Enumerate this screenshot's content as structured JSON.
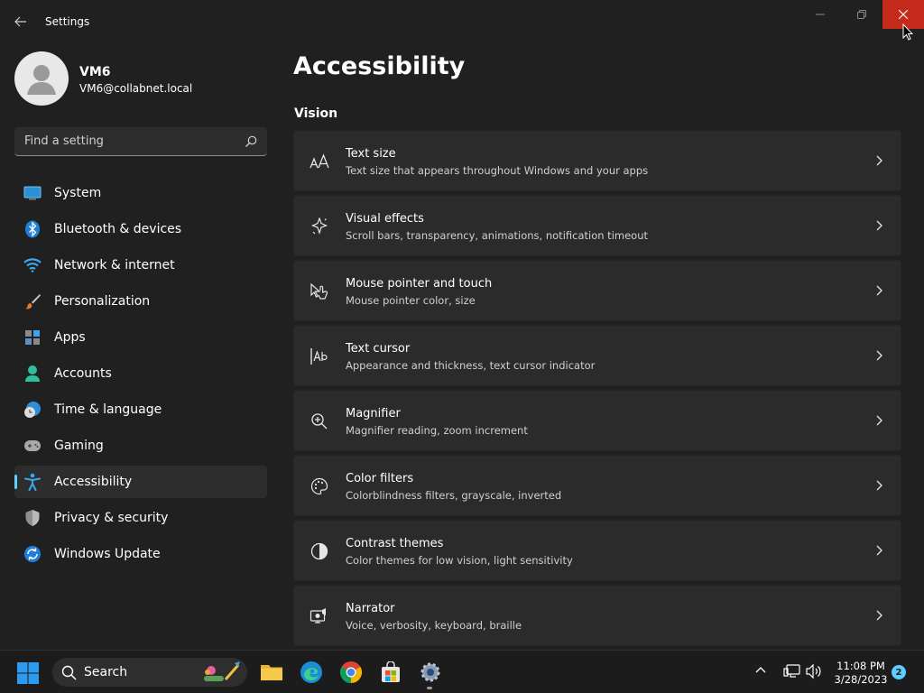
{
  "window": {
    "title": "Settings"
  },
  "profile": {
    "name": "VM6",
    "email": "VM6@collabnet.local"
  },
  "search": {
    "placeholder": "Find a setting"
  },
  "sidebar": {
    "items": [
      {
        "label": "System",
        "icon": "system-icon"
      },
      {
        "label": "Bluetooth & devices",
        "icon": "bluetooth-icon"
      },
      {
        "label": "Network & internet",
        "icon": "wifi-icon"
      },
      {
        "label": "Personalization",
        "icon": "brush-icon"
      },
      {
        "label": "Apps",
        "icon": "apps-icon"
      },
      {
        "label": "Accounts",
        "icon": "accounts-icon"
      },
      {
        "label": "Time & language",
        "icon": "globe-clock-icon"
      },
      {
        "label": "Gaming",
        "icon": "gamepad-icon"
      },
      {
        "label": "Accessibility",
        "icon": "accessibility-icon",
        "active": true
      },
      {
        "label": "Privacy & security",
        "icon": "shield-icon"
      },
      {
        "label": "Windows Update",
        "icon": "update-icon"
      }
    ]
  },
  "main": {
    "title": "Accessibility",
    "section": "Vision",
    "cards": [
      {
        "title": "Text size",
        "description": "Text size that appears throughout Windows and your apps",
        "icon": "text-size-icon"
      },
      {
        "title": "Visual effects",
        "description": "Scroll bars, transparency, animations, notification timeout",
        "icon": "sparkle-icon"
      },
      {
        "title": "Mouse pointer and touch",
        "description": "Mouse pointer color, size",
        "icon": "pointer-touch-icon"
      },
      {
        "title": "Text cursor",
        "description": "Appearance and thickness, text cursor indicator",
        "icon": "text-cursor-icon"
      },
      {
        "title": "Magnifier",
        "description": "Magnifier reading, zoom increment",
        "icon": "magnifier-icon"
      },
      {
        "title": "Color filters",
        "description": "Colorblindness filters, grayscale, inverted",
        "icon": "palette-icon"
      },
      {
        "title": "Contrast themes",
        "description": "Color themes for low vision, light sensitivity",
        "icon": "contrast-icon"
      },
      {
        "title": "Narrator",
        "description": "Voice, verbosity, keyboard, braille",
        "icon": "narrator-icon"
      }
    ]
  },
  "taskbar": {
    "search_label": "Search",
    "time": "11:08 PM",
    "date": "3/28/2023",
    "notification_count": "2"
  },
  "colors": {
    "accent": "#60cdff",
    "close": "#c42b1c",
    "background": "#202020",
    "card": "#2b2b2b"
  }
}
